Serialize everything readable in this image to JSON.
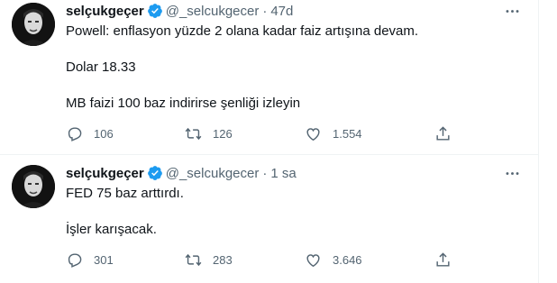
{
  "tweets": [
    {
      "name": "selçukgeçer",
      "handle": "@_selcukgecer",
      "separator": "·",
      "time": "47d",
      "lines": [
        "Powell: enflasyon yüzde 2 olana kadar faiz artışına devam.",
        "Dolar 18.33",
        "MB faizi 100 baz indirirse şenliği izleyin"
      ],
      "replies": "106",
      "retweets": "126",
      "likes": "1.554"
    },
    {
      "name": "selçukgeçer",
      "handle": "@_selcukgecer",
      "separator": "·",
      "time": "1 sa",
      "lines": [
        "FED 75 baz arttırdı.",
        "İşler karışacak."
      ],
      "replies": "301",
      "retweets": "283",
      "likes": "3.646"
    }
  ],
  "icons": {
    "verified": "verified-badge-icon",
    "more": "more-horizontal-icon",
    "reply": "reply-icon",
    "retweet": "retweet-icon",
    "like": "heart-icon",
    "share": "share-icon"
  },
  "colors": {
    "verified": "#1d9bf0",
    "secondary_text": "#536471",
    "primary_text": "#0f1419",
    "divider": "#eff3f4"
  }
}
